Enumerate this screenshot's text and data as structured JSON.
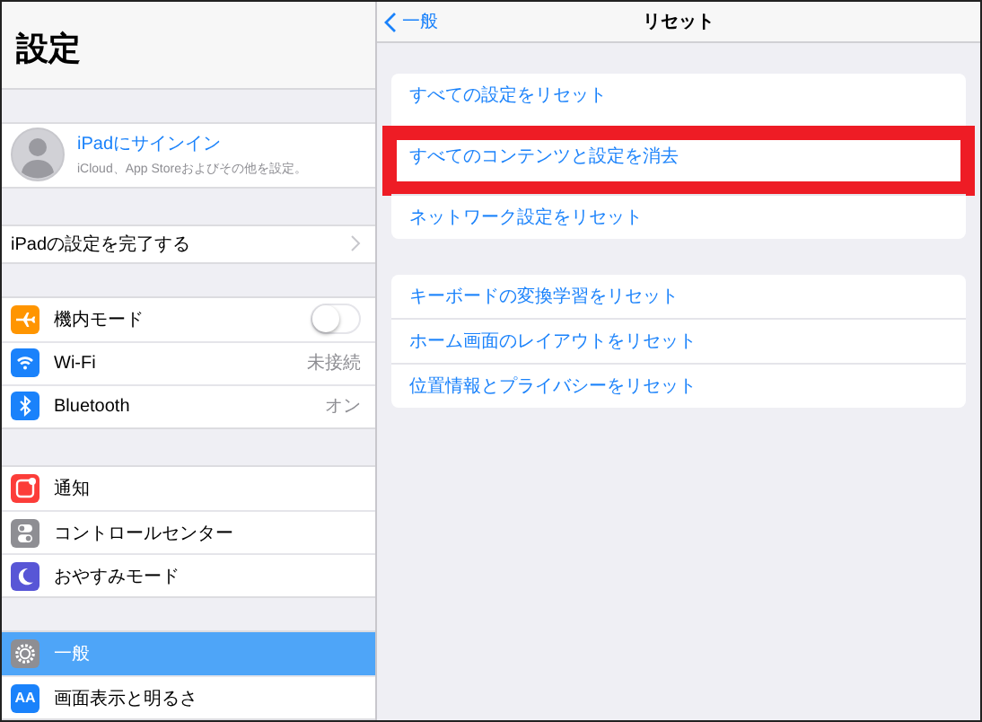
{
  "sidebar": {
    "title": "設定",
    "account": {
      "name": "iPadにサインイン",
      "subtitle": "iCloud、App Storeおよびその他を設定。"
    },
    "setup_row": {
      "label": "iPadの設定を完了する"
    },
    "groups": [
      [
        {
          "label": "機内モード",
          "color": "#ff9500",
          "kind": "toggle",
          "on": false,
          "selected": false
        },
        {
          "label": "Wi-Fi",
          "color": "#1a82fb",
          "kind": "value",
          "value": "未接続",
          "selected": false
        },
        {
          "label": "Bluetooth",
          "color": "#1a82fb",
          "kind": "value",
          "value": "オン",
          "selected": false
        }
      ],
      [
        {
          "label": "通知",
          "color": "#fc3d39",
          "kind": "plain",
          "selected": false
        },
        {
          "label": "コントロールセンター",
          "color": "#8e8e93",
          "kind": "plain",
          "selected": false
        },
        {
          "label": "おやすみモード",
          "color": "#5856d6",
          "kind": "plain",
          "selected": false
        }
      ],
      [
        {
          "label": "一般",
          "color": "#8e8e93",
          "kind": "plain",
          "selected": true
        },
        {
          "label": "画面表示と明るさ",
          "icon_label": "AA",
          "color": "#1a82fb",
          "kind": "plain",
          "selected": false
        }
      ]
    ]
  },
  "detail": {
    "back": "一般",
    "title": "リセット",
    "groups": [
      [
        {
          "label": "すべての設定をリセット",
          "highlighted": false
        },
        {
          "label": "すべてのコンテンツと設定を消去",
          "highlighted": true
        },
        {
          "label": "ネットワーク設定をリセット",
          "highlighted": false
        }
      ],
      [
        {
          "label": "キーボードの変換学習をリセット",
          "highlighted": false
        },
        {
          "label": "ホーム画面のレイアウトをリセット",
          "highlighted": false
        },
        {
          "label": "位置情報とプライバシーをリセット",
          "highlighted": false
        }
      ]
    ]
  }
}
